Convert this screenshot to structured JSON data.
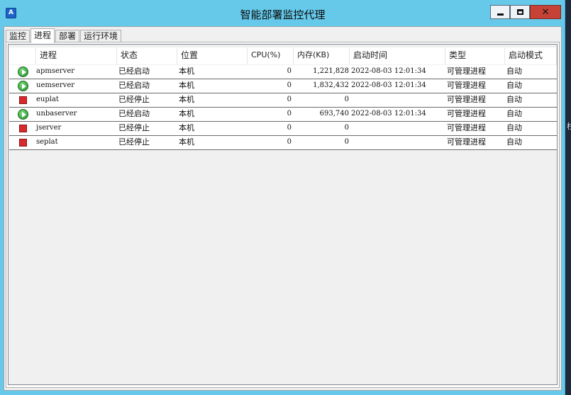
{
  "window": {
    "title": "智能部署监控代理",
    "app_icon": "app-icon",
    "minimize": "minimize-icon",
    "maximize": "maximize-icon",
    "close": "✕"
  },
  "tabs": [
    {
      "label": "监控",
      "active": false
    },
    {
      "label": "进程",
      "active": true
    },
    {
      "label": "部署",
      "active": false
    },
    {
      "label": "运行环境",
      "active": false
    }
  ],
  "columns": [
    "进程",
    "状态",
    "位置",
    "CPU(%)",
    "内存(KB)",
    "启动时间",
    "类型",
    "启动模式"
  ],
  "rows": [
    {
      "icon": "running-icon",
      "name": "apmserver",
      "status": "已经启动",
      "location": "本机",
      "cpu": "0",
      "memory": "1,221,828",
      "start_time": "2022-08-03 12:01:34",
      "type": "可管理进程",
      "mode": "自动"
    },
    {
      "icon": "running-icon",
      "name": "uemserver",
      "status": "已经启动",
      "location": "本机",
      "cpu": "0",
      "memory": "1,832,432",
      "start_time": "2022-08-03 12:01:34",
      "type": "可管理进程",
      "mode": "自动"
    },
    {
      "icon": "stopped-icon",
      "name": "euplat",
      "status": "已经停止",
      "location": "本机",
      "cpu": "0",
      "memory": "0",
      "start_time": "",
      "type": "可管理进程",
      "mode": "自动"
    },
    {
      "icon": "running-icon",
      "name": "unbaserver",
      "status": "已经启动",
      "location": "本机",
      "cpu": "0",
      "memory": "693,740",
      "start_time": "2022-08-03 12:01:34",
      "type": "可管理进程",
      "mode": "自动"
    },
    {
      "icon": "stopped-icon",
      "name": "jserver",
      "status": "已经停止",
      "location": "本机",
      "cpu": "0",
      "memory": "0",
      "start_time": "",
      "type": "可管理进程",
      "mode": "自动"
    },
    {
      "icon": "stopped-icon",
      "name": "seplat",
      "status": "已经停止",
      "location": "本机",
      "cpu": "0",
      "memory": "0",
      "start_time": "",
      "type": "可管理进程",
      "mode": "自动"
    }
  ],
  "colors": {
    "titlebar": "#66c9ea",
    "close": "#c74236",
    "running": "#1f8f2c",
    "stopped": "#d82a2a"
  },
  "side_fragment": "柱"
}
